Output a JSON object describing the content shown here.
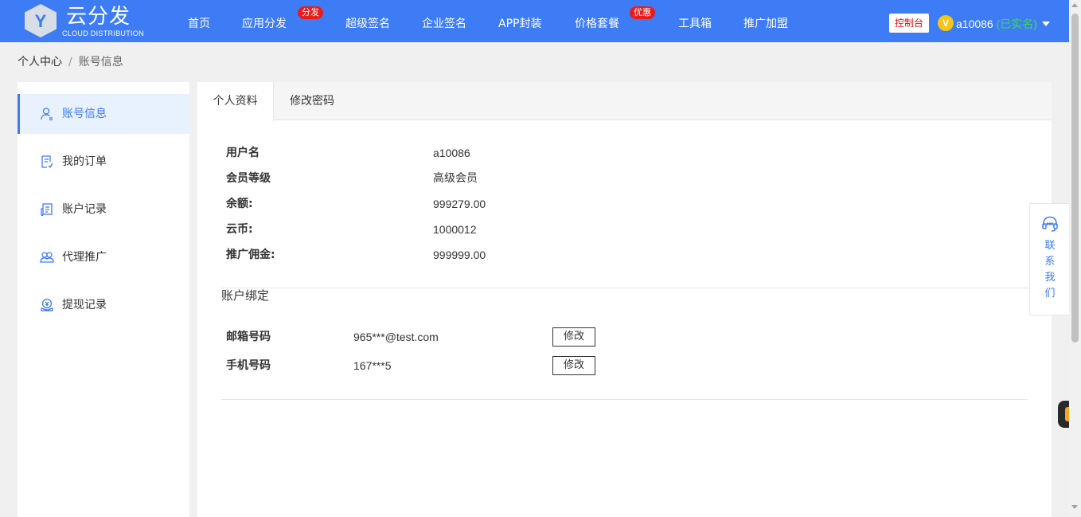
{
  "header": {
    "logo_text": "云分发",
    "logo_subtext": "CLOUD DISTRIBUTION",
    "logo_letter": "Y",
    "nav": [
      {
        "label": "首页"
      },
      {
        "label": "应用分发",
        "badge": "分发"
      },
      {
        "label": "超级签名"
      },
      {
        "label": "企业签名"
      },
      {
        "label": "APP封装"
      },
      {
        "label": "价格套餐",
        "badge": "优惠"
      },
      {
        "label": "工具箱"
      },
      {
        "label": "推广加盟"
      }
    ],
    "console_label": "控制台",
    "vip_letter": "V",
    "username": "a10086",
    "verified": "(已实名)"
  },
  "breadcrumb": {
    "root": "个人中心",
    "separator": "/",
    "current": "账号信息"
  },
  "sidebar": {
    "items": [
      {
        "label": "账号信息",
        "icon": "user-icon"
      },
      {
        "label": "我的订单",
        "icon": "order-icon"
      },
      {
        "label": "账户记录",
        "icon": "record-icon"
      },
      {
        "label": "代理推广",
        "icon": "agent-icon"
      },
      {
        "label": "提现记录",
        "icon": "withdraw-icon"
      }
    ]
  },
  "tabs": [
    {
      "label": "个人资料"
    },
    {
      "label": "修改密码"
    }
  ],
  "profile": {
    "rows": [
      {
        "label": "用户名",
        "value": "a10086"
      },
      {
        "label": "会员等级",
        "value": "高级会员"
      },
      {
        "label": "余额:",
        "value": "999279.00"
      },
      {
        "label": "云币:",
        "value": "1000012"
      },
      {
        "label": "推广佣金:",
        "value": "999999.00"
      }
    ]
  },
  "binding": {
    "title": "账户绑定",
    "rows": [
      {
        "label": "邮箱号码",
        "value": "965***@test.com",
        "button": "修改"
      },
      {
        "label": "手机号码",
        "value": "167***5",
        "button": "修改"
      }
    ]
  },
  "contact": {
    "chars": [
      "联",
      "系",
      "我",
      "们"
    ]
  },
  "colors": {
    "primary": "#3d7cf5",
    "badge": "#e81c1c",
    "verified": "#3ddc4c",
    "vip": "#f5c518"
  }
}
